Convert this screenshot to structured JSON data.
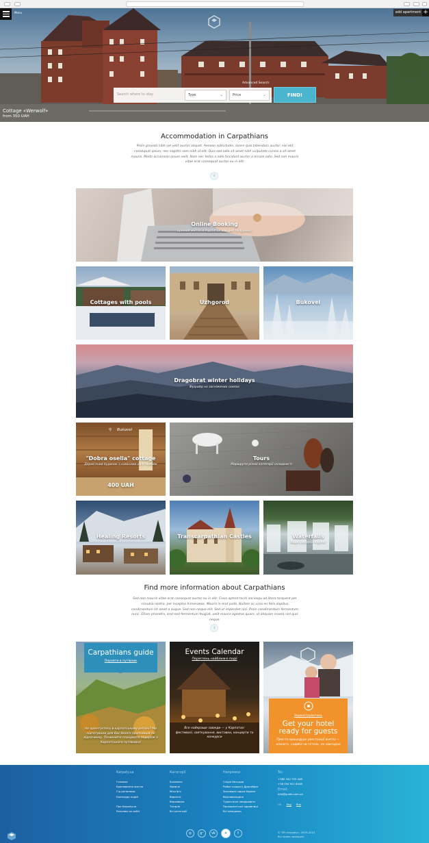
{
  "header": {
    "add_apartment": "add apartment",
    "plus": "+",
    "menu_label": "Menu"
  },
  "search": {
    "advanced": "Advanced Search",
    "placeholder": "Search where to stay",
    "type": "Type",
    "price": "Price",
    "find": "FIND!"
  },
  "hero": {
    "title": "Cottage «Werwolf»",
    "price": "from 350 UAH"
  },
  "intro": {
    "title": "Accommodation in Carpathians",
    "text": "Proin gravida nibh vel velit auctor aliquet. Aenean sollicitudin, lorem quis bibendum auctor, nisi elit consequat ipsum, nec sagittis sem nibh id elit. Duis sed odio sit amet nibh vulputate cursus a sit amet mauris. Morbi accumsan ipsum velit. Nam nec tellus a odio tincidunt auctor a ornare odio. Sed non mauris vitae erat consequat auctor eu in elit."
  },
  "tiles": {
    "online": {
      "title": "Online Booking",
      "sub": "Бронюй житло в Карпатах швидко та зручно!"
    },
    "cottages": {
      "title": "Cottages with pools"
    },
    "uzhgorod": {
      "title": "Uzhgorod"
    },
    "bukovel": {
      "title": "Bukovel"
    },
    "dragobrat": {
      "title": "Dragobrat winter holidays",
      "sub": "Фрірайд на засніжених схилах"
    },
    "dobra": {
      "location": "Bukovel",
      "title": "\"Dobra osella\" cottage",
      "sub": "Дерев'яний будинок з камінами на 8 чоловік",
      "price": "400 UAH"
    },
    "tours": {
      "title": "Tours",
      "sub": "Маршрути різної категорії складності"
    },
    "healing": {
      "title": "Healing Resorts"
    },
    "castles": {
      "title": "Transcarpathian Castles"
    },
    "waterfalls": {
      "title": "Waterfalls",
      "sub": "Водні ресурси Карпат"
    }
  },
  "more": {
    "title": "Find more information about Carpathians",
    "text": "Sed non mauris vitae erat consequat auctor eu in elit. Class aptent taciti sociosqu ad litora torquent per conubia nostra, per inceptos himenaeos. Mauris in erat justo. Nullam ac urna eu felis dapibus condimentum sit amet a augue. Sed non neque elit. Sed ut imperdiet nisi. Proin condimentum fermentum nunc. Etiam pharetra, erat sed fermentum feugiat, velit mauris egestas quam, ut aliquam massa nisl quis neque."
  },
  "cards": {
    "guide": {
      "title": "Carpathians guide",
      "link": "Перейти в путівник",
      "text": "Не орієнтуєтесь в карпатському регіоні? Ми підготували для Вас безліч пропозицій по відпочинку. Починайте планувати подорож з Карпатського путівника!"
    },
    "events": {
      "title": "Events Calendar",
      "link": "Переглянь найближчі події",
      "text": "Все найкраще завжди — у Карпатах: фестивалі, святкування, виставки, концерти та конкурси"
    },
    "hotel": {
      "link": "Зареєструватись",
      "title": "Get your hotel ready for guests",
      "text": "Проста процедура реєстрації житла — кімната, садиба чи готель, як завгодно"
    }
  },
  "footer": {
    "col1": {
      "title": "Karpaty.ua",
      "links": [
        "Головна",
        "Бронювання житла",
        "Гід регіонами",
        "Календар подій",
        "",
        "Про Karpaty.ua",
        "Реклама на сайті"
      ]
    },
    "col2": {
      "title": "Категорії",
      "links": [
        "Буковель",
        "Ярмиче",
        "Міжгір'я",
        "Ворохта",
        "Верховина",
        "Татарів",
        "Всі категорії"
      ]
    },
    "col3": {
      "title": "Напрямки",
      "links": [
        "Східні Бескиди",
        "Район курорту Драгобрат",
        "Заповідні парки Карпат",
        "Верховинщина",
        "Туристичні ландшафти",
        "Прикарпатські здравниці",
        "Всі напрямки"
      ]
    },
    "col4": {
      "tel_label": "Tel:",
      "phones": [
        "+380 342 755 448",
        "+38 094 922 8448"
      ],
      "email_label": "Email:",
      "email": "info@guide.com.ua",
      "lang_label": "UA",
      "langs": [
        "Eng",
        "Rus"
      ]
    },
    "copyright": [
      "© ТМ «Karpaty», 2009-2015",
      "Всі права захищені"
    ],
    "social": [
      "instagram-icon",
      "google-plus-icon",
      "vk-icon",
      "twitter-icon",
      "facebook-icon"
    ]
  }
}
